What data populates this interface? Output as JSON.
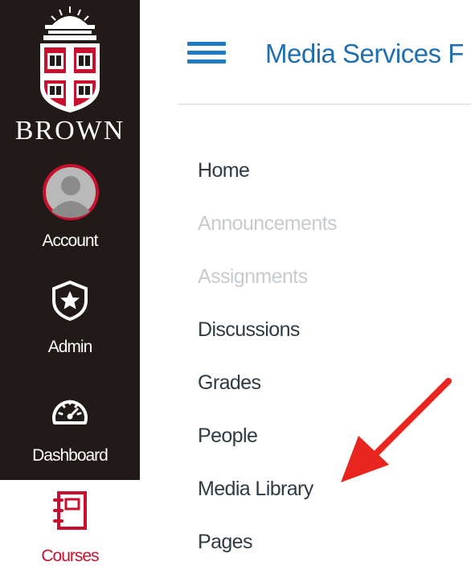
{
  "global_nav": {
    "brand_name": "BROWN",
    "items": [
      {
        "label": "Account",
        "icon": "user-avatar-icon"
      },
      {
        "label": "Admin",
        "icon": "shield-star-icon"
      },
      {
        "label": "Dashboard",
        "icon": "speedometer-icon"
      },
      {
        "label": "Courses",
        "icon": "notebook-icon",
        "active": true
      }
    ],
    "background": "#221a18",
    "active_color": "#c8102e"
  },
  "header": {
    "menu_icon": "hamburger-icon",
    "course_title": "Media Services F"
  },
  "course_nav": {
    "items": [
      {
        "label": "Home",
        "enabled": true
      },
      {
        "label": "Announcements",
        "enabled": false
      },
      {
        "label": "Assignments",
        "enabled": false
      },
      {
        "label": "Discussions",
        "enabled": true
      },
      {
        "label": "Grades",
        "enabled": true
      },
      {
        "label": "People",
        "enabled": true
      },
      {
        "label": "Media Library",
        "enabled": true
      },
      {
        "label": "Pages",
        "enabled": true
      }
    ]
  },
  "annotation": {
    "icon": "red-arrow-icon",
    "color": "#e8261f",
    "points_to": "Media Library"
  }
}
